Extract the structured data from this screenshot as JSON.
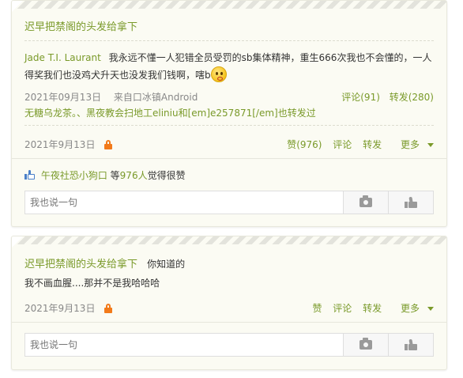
{
  "post1": {
    "author": "迟早把禁阁的头发给拿下",
    "original": {
      "author": "Jade T.I. Laurant",
      "text": "我永远不懂一人犯错全员受罚的sb集体精神，重生666次我也不会懂的，一人得奖我们也没鸡犬升天也没发我们钱啊，嗐b",
      "date": "2021年09月13日",
      "source": "来自口冰镇Android",
      "comments": "评论(91)",
      "reposts": "转发(280)",
      "repost_chain": "无糖乌龙茶。、黑夜教会扫地工eliniu和[em]e257871[/em]也转发过"
    },
    "date": "2021年9月13日",
    "actions": {
      "like": "赞(976)",
      "comment": "评论",
      "repost": "转发",
      "more": "更多"
    },
    "likes": {
      "user": "午夜社恐小狗口",
      "middle": " 等",
      "count": "976人",
      "suffix": "觉得很赞"
    },
    "comment_placeholder": "我也说一句"
  },
  "post2": {
    "author": "迟早把禁阁的头发给拿下",
    "text_inline": "你知道的",
    "text_line2": "我不画血腥....那并不是我哈哈哈",
    "date": "2021年9月13日",
    "actions": {
      "like": "赞",
      "comment": "评论",
      "repost": "转发",
      "more": "更多"
    },
    "comment_placeholder": "我也说一句"
  },
  "colors": {
    "link": "#7a9a2a",
    "lock": "#f27a1a",
    "card_bg": "#fbfbf3",
    "like_blue": "#4a7fc8"
  }
}
